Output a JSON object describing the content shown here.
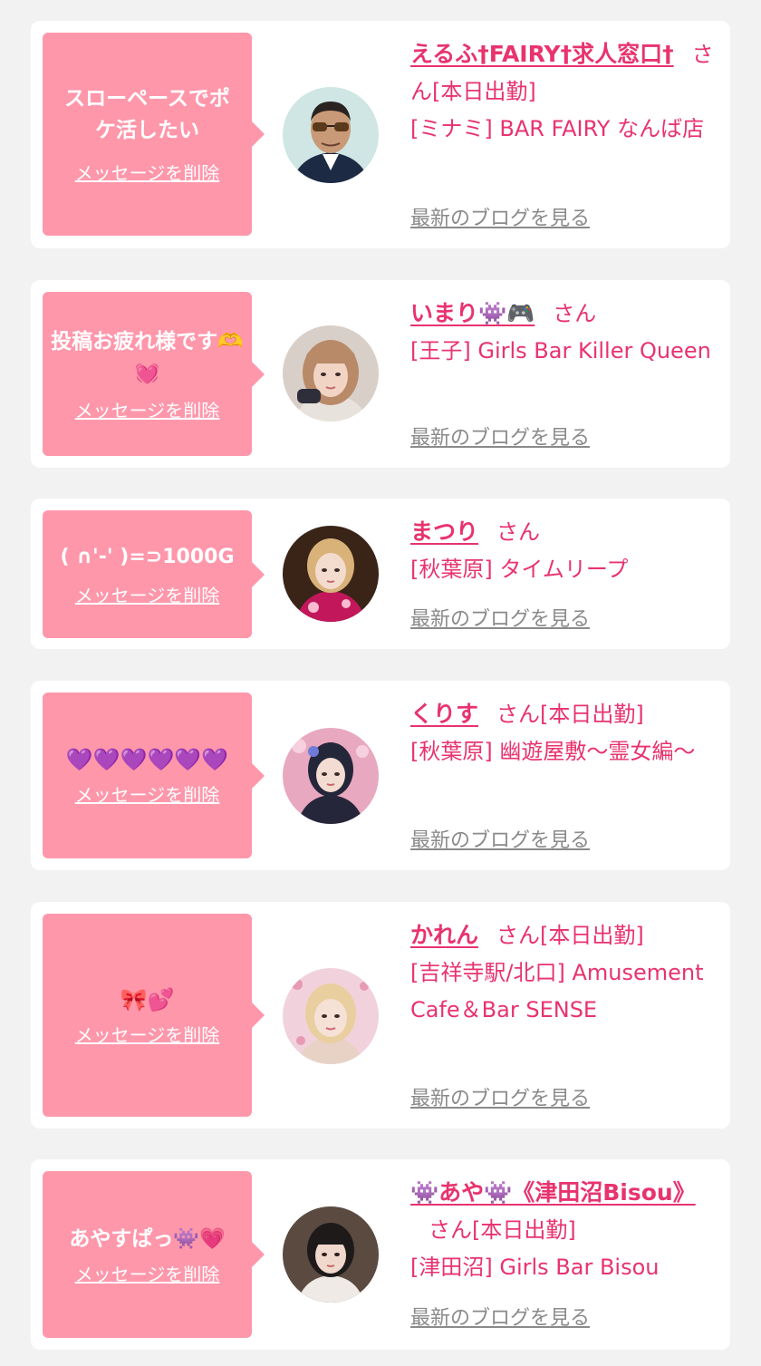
{
  "colors": {
    "page_bg": "#f2f2f2",
    "card_bg": "#ffffff",
    "bubble": "#ff97ab",
    "accent": "#e8336e",
    "muted_link": "#8a8a8a"
  },
  "entries": [
    {
      "message": "スローペースでポケ活したい",
      "delete_label": "メッセージを削除",
      "avatar_icon": "avatar-man-sunglasses",
      "name": "えるふ†FAIRY†求人窓口†",
      "honorific": "さん",
      "status": "[本日出勤]",
      "shop": "[ミナミ] BAR FAIRY なんば店",
      "blog_label": "最新のブログを見る"
    },
    {
      "message": "投稿お疲れ様です🫶💓",
      "delete_label": "メッセージを削除",
      "avatar_icon": "avatar-woman-blonde",
      "name": "いまり👾🎮",
      "honorific": "さん",
      "status": "",
      "shop": "[王子] Girls Bar Killer Queen",
      "blog_label": "最新のブログを見る"
    },
    {
      "message": "( ∩'-' )=⊃1000G",
      "delete_label": "メッセージを削除",
      "avatar_icon": "avatar-woman-kimono",
      "name": "まつり",
      "honorific": "さん",
      "status": "",
      "shop": "[秋葉原] タイムリープ",
      "blog_label": "最新のブログを見る"
    },
    {
      "message": "💜💜💜💜💜💜",
      "delete_label": "メッセージを削除",
      "avatar_icon": "avatar-woman-dark-hair",
      "name": "くりす",
      "honorific": "さん",
      "status": "[本日出勤]",
      "shop": "[秋葉原] 幽遊屋敷～霊女編～",
      "blog_label": "最新のブログを見る"
    },
    {
      "message": "🎀💕",
      "delete_label": "メッセージを削除",
      "avatar_icon": "avatar-woman-light-hair",
      "name": "かれん",
      "honorific": "さん",
      "status": "[本日出勤]",
      "shop": "[吉祥寺駅/北口] Amusement Cafe＆Bar SENSE",
      "blog_label": "最新のブログを見る"
    },
    {
      "message": "あやすぱっ👾💗",
      "delete_label": "メッセージを削除",
      "avatar_icon": "avatar-woman-short-hair",
      "name": "👾あや👾《津田沼Bisou》",
      "honorific": "さん",
      "status": "[本日出勤]",
      "shop": "[津田沼] Girls Bar Bisou",
      "blog_label": "最新のブログを見る"
    }
  ]
}
